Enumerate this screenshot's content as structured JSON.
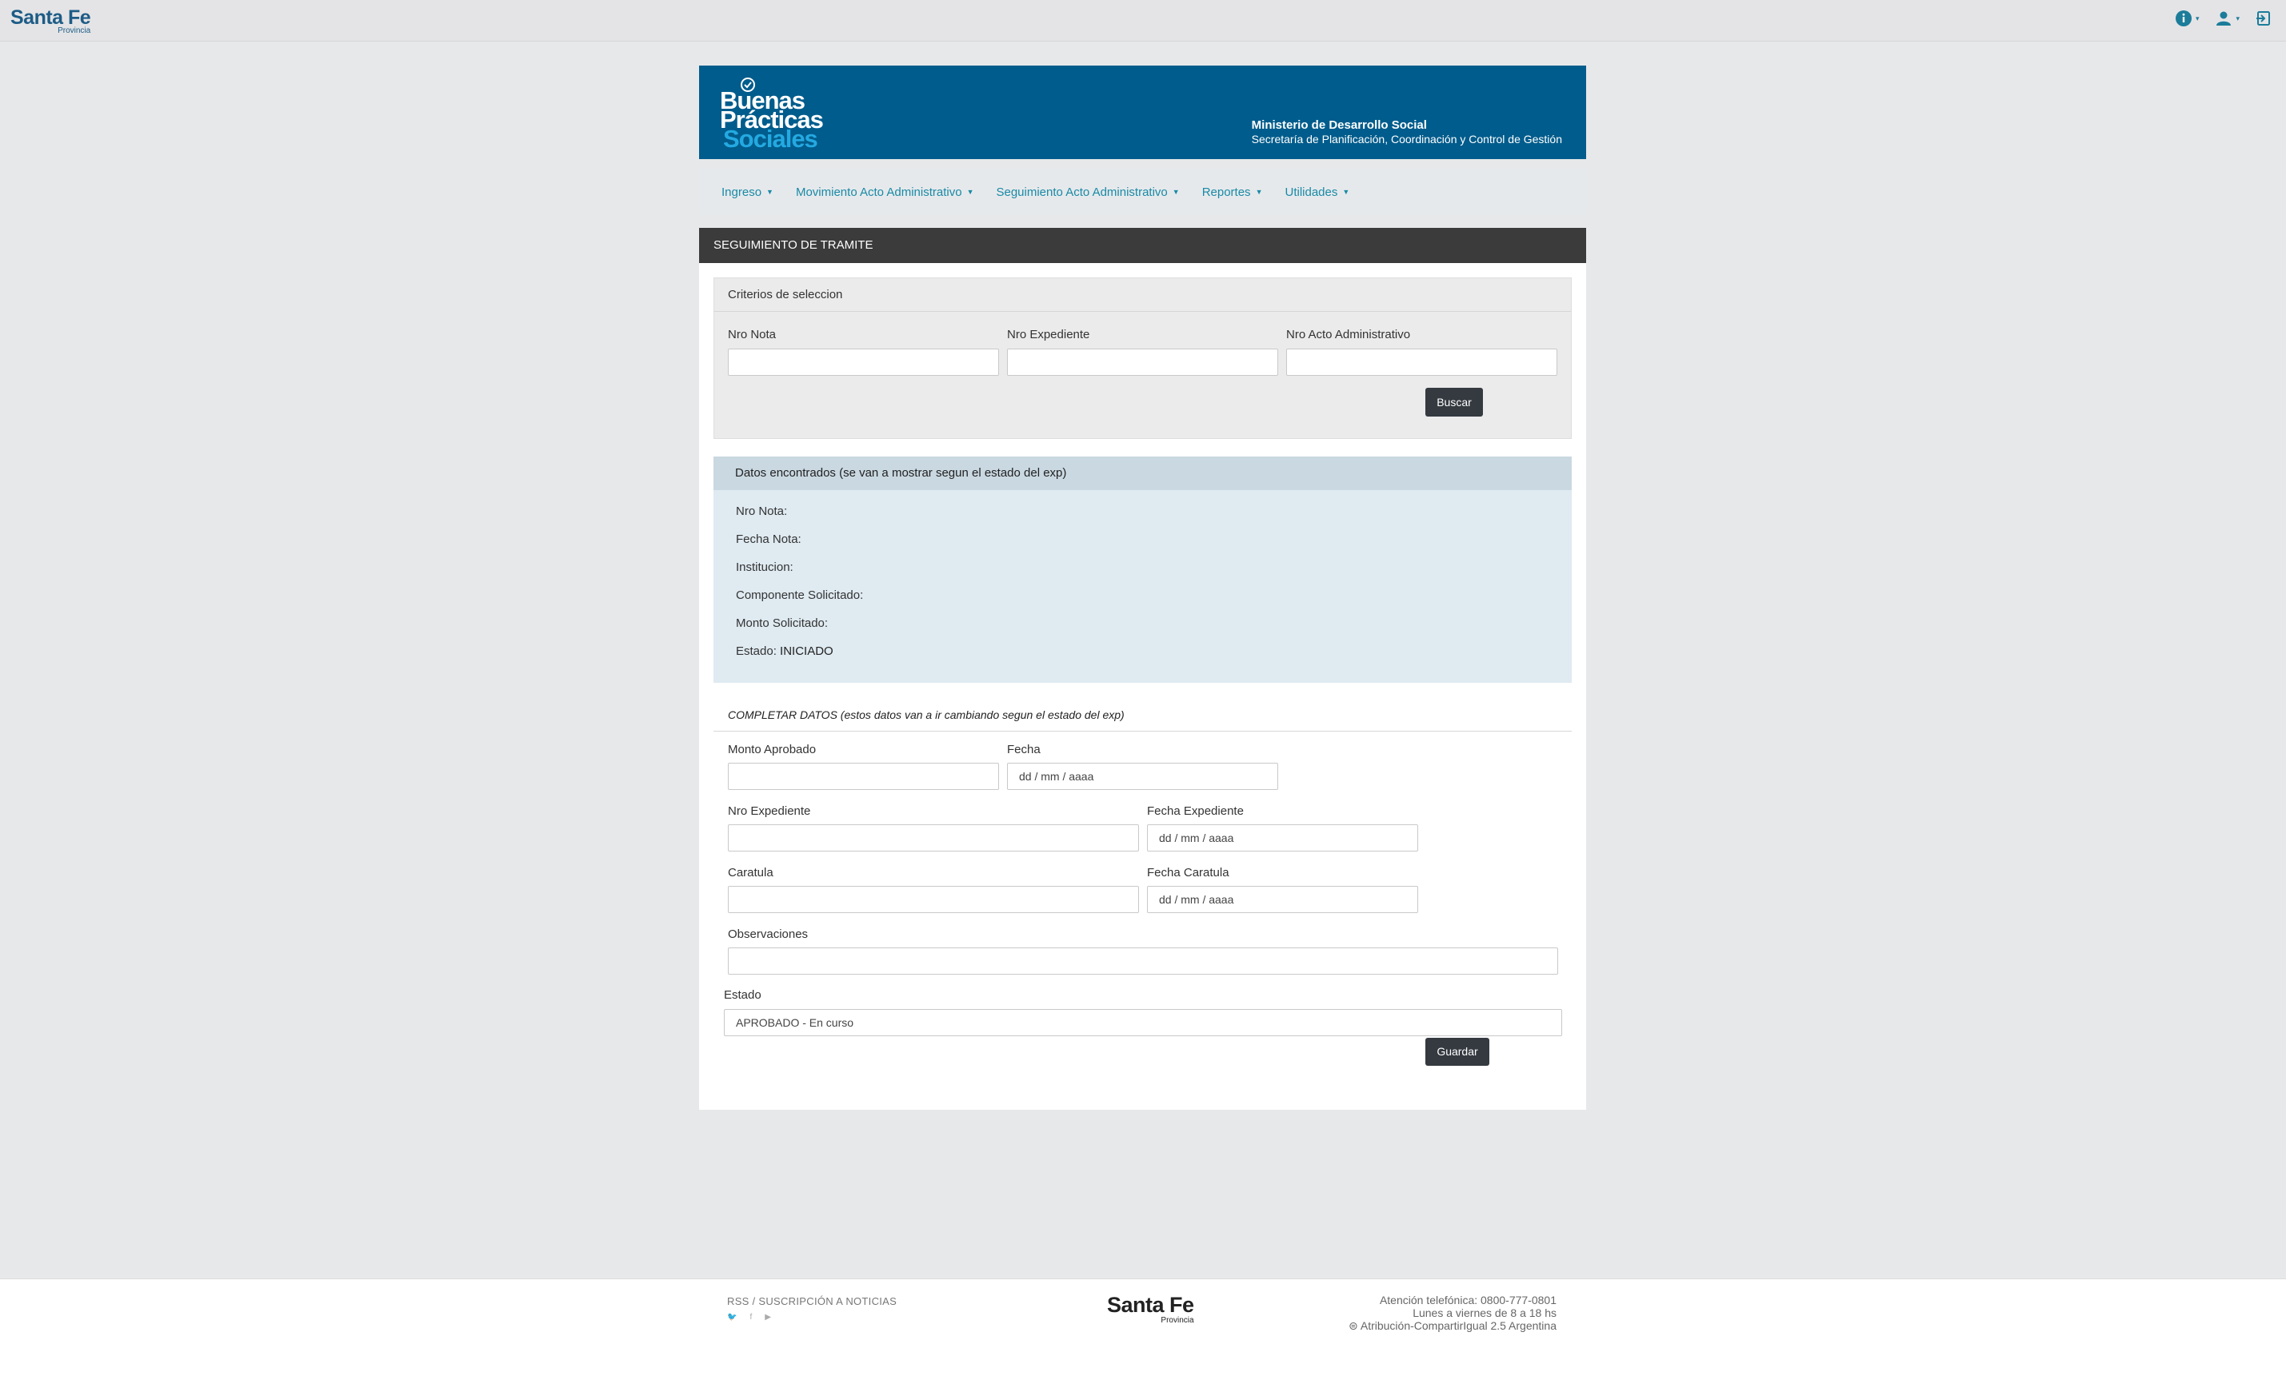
{
  "topbar": {
    "brand_main": "Santa Fe",
    "brand_sub": "Provincia",
    "icons": [
      "info-icon",
      "user-icon",
      "logout-icon"
    ]
  },
  "banner": {
    "logo_line1": "Buenas",
    "logo_line2": "Prácticas",
    "logo_line3": "Sociales",
    "ministry_line1": "Ministerio de Desarrollo Social",
    "ministry_line2": "Secretaría de Planificación, Coordinación y Control de Gestión",
    "colors": {
      "banner": "#005c8c",
      "accent": "#24a9e1"
    }
  },
  "nav": {
    "items": [
      {
        "label": "Ingreso"
      },
      {
        "label": "Movimiento Acto Administrativo"
      },
      {
        "label": "Seguimiento Acto Administrativo"
      },
      {
        "label": "Reportes"
      },
      {
        "label": "Utilidades"
      }
    ]
  },
  "panel": {
    "title": "SEGUIMIENTO DE TRAMITE"
  },
  "criteria": {
    "title": "Criterios de seleccion",
    "nro_nota_label": "Nro Nota",
    "nro_nota_value": "",
    "nro_expediente_label": "Nro Expediente",
    "nro_expediente_value": "",
    "nro_acto_label": "Nro Acto Administrativo",
    "nro_acto_value": "",
    "search_label": "Buscar"
  },
  "results": {
    "title": "Datos encontrados (se van a mostrar segun el estado del exp)",
    "nro_nota_label": "Nro Nota:",
    "fecha_nota_label": "Fecha Nota:",
    "institucion_label": "Institucion:",
    "componente_label": "Componente Solicitado:",
    "monto_label": "Monto Solicitado:",
    "estado_label": "Estado:",
    "estado_value": "INICIADO"
  },
  "complete": {
    "title": "COMPLETAR DATOS (estos datos van a ir cambiando segun el estado del exp)",
    "monto_aprobado_label": "Monto Aprobado",
    "monto_aprobado_value": "",
    "fecha_label": "Fecha",
    "fecha_value": "dd / mm / aaaa",
    "nro_expediente_label": "Nro Expediente",
    "nro_expediente_value": "",
    "fecha_expediente_label": "Fecha Expediente",
    "fecha_expediente_value": "dd / mm / aaaa",
    "caratula_label": "Caratula",
    "caratula_value": "",
    "fecha_caratula_label": "Fecha Caratula",
    "fecha_caratula_value": "dd / mm / aaaa",
    "observaciones_label": "Observaciones",
    "observaciones_value": "",
    "estado_label": "Estado",
    "estado_value": "APROBADO - En curso",
    "save_label": "Guardar"
  },
  "footer": {
    "rss_label": "RSS / SUSCRIPCIÓN A NOTICIAS",
    "social": [
      "twitter-icon",
      "facebook-icon",
      "youtube-icon"
    ],
    "brand_main": "Santa Fe",
    "brand_sub": "Provincia",
    "phone_line": "Atención telefónica: 0800-777-0801",
    "hours_line": "Lunes a viernes de 8 a 18 hs",
    "license_line": "Atribución-CompartirIgual 2.5 Argentina"
  }
}
